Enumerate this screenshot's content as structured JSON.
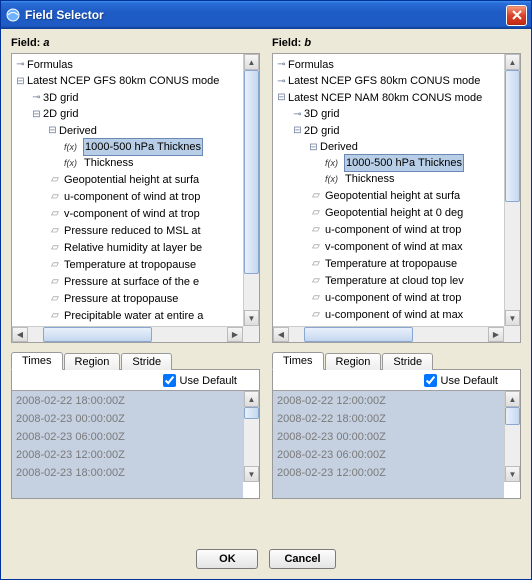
{
  "window": {
    "title": "Field Selector"
  },
  "buttons": {
    "ok": "OK",
    "cancel": "Cancel"
  },
  "tabs": {
    "times": "Times",
    "region": "Region",
    "stride": "Stride",
    "use_default": "Use Default"
  },
  "fieldA": {
    "label_prefix": "Field:",
    "label_var": "a",
    "tree": {
      "formulas": "Formulas",
      "source": "Latest NCEP GFS 80km CONUS mode",
      "grid3d": "3D grid",
      "grid2d": "2D grid",
      "derived": "Derived",
      "sel": "1000-500 hPa Thicknes",
      "thickness": "Thickness",
      "leaves": [
        "Geopotential height at surfa",
        "u-component of wind at trop",
        "v-component of wind at trop",
        "Pressure reduced to MSL at",
        "Relative humidity at layer be",
        "Temperature at tropopause",
        "Pressure at surface of the e",
        "Pressure at tropopause",
        "Precipitable water at entire a"
      ]
    },
    "times": [
      "2008-02-22 18:00:00Z",
      "2008-02-23 00:00:00Z",
      "2008-02-23 06:00:00Z",
      "2008-02-23 12:00:00Z",
      "2008-02-23 18:00:00Z"
    ]
  },
  "fieldB": {
    "label_prefix": "Field:",
    "label_var": "b",
    "tree": {
      "formulas": "Formulas",
      "source1": "Latest NCEP GFS 80km CONUS mode",
      "source2": "Latest NCEP NAM 80km CONUS mode",
      "grid3d": "3D grid",
      "grid2d": "2D grid",
      "derived": "Derived",
      "sel": "1000-500 hPa Thicknes",
      "thickness": "Thickness",
      "leaves": [
        "Geopotential height at surfa",
        "Geopotential height at 0 deg",
        "u-component of wind at trop",
        "v-component of wind at max",
        "Temperature at tropopause",
        "Temperature at cloud top lev",
        "u-component of wind at trop",
        "u-component of wind at max"
      ]
    },
    "times": [
      "2008-02-22 12:00:00Z",
      "2008-02-22 18:00:00Z",
      "2008-02-23 00:00:00Z",
      "2008-02-23 06:00:00Z",
      "2008-02-23 12:00:00Z"
    ]
  }
}
